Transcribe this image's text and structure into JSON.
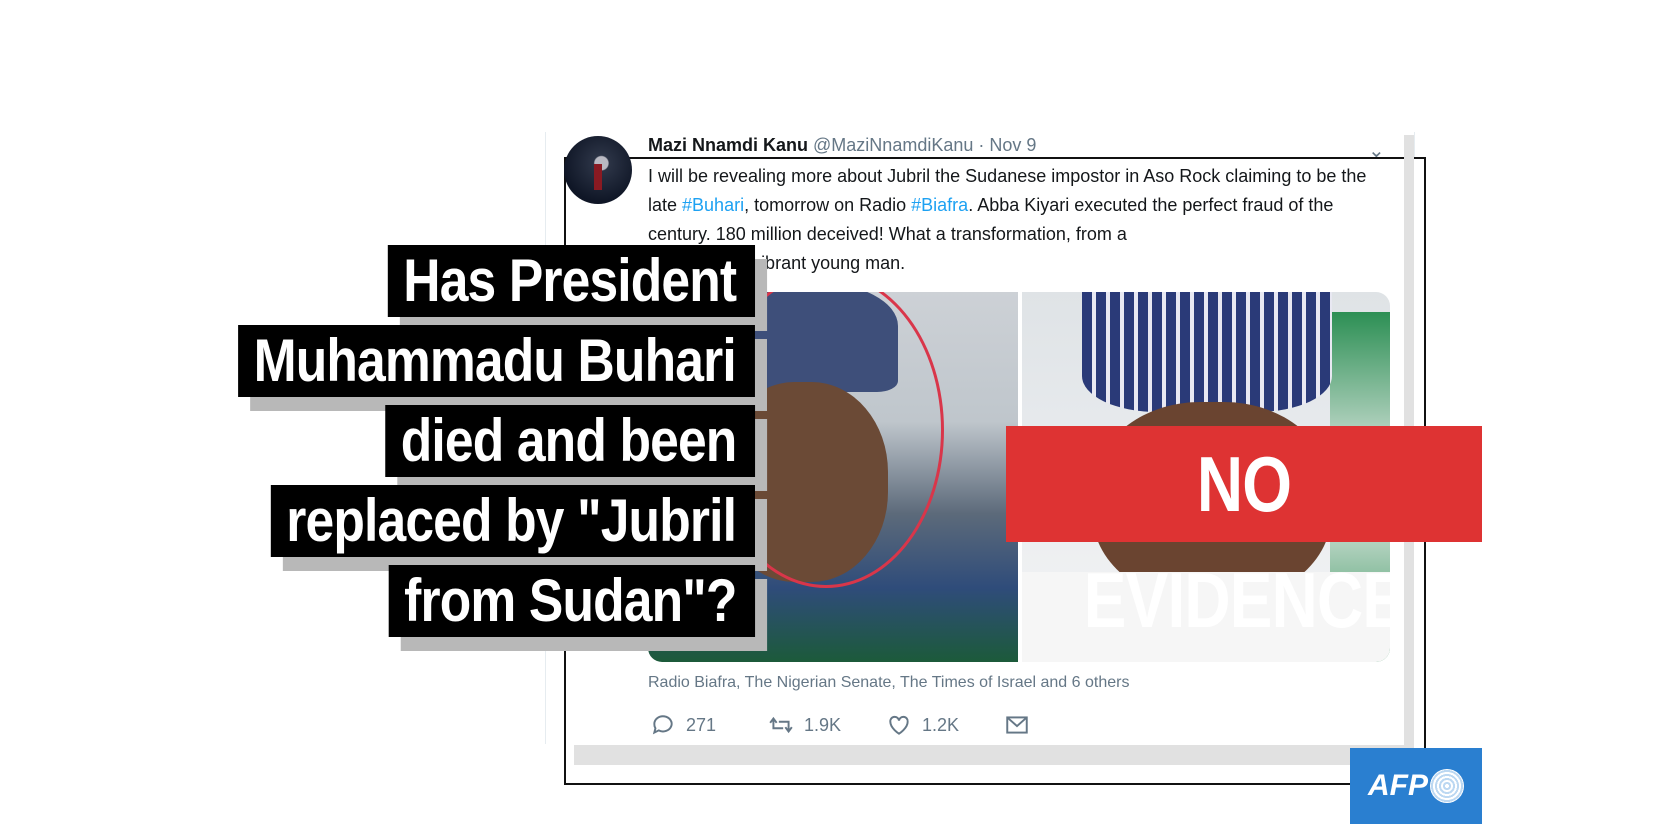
{
  "tweet": {
    "name": "Mazi Nnamdi Kanu",
    "handle": "@MaziNnamdiKanu",
    "separator": " · ",
    "date": "Nov 9",
    "text_1": "I will be revealing more about Jubril the Sudanese impostor in Aso Rock claiming to be the late ",
    "hashtag_1": "#Buhari",
    "text_2": ", tomorrow on Radio ",
    "hashtag_2": "#Biafra",
    "text_3": ". Abba Kiyari executed the perfect fraud of the century. 180 million deceived! What a transformation, from a",
    "text_4": "old man to a vibrant young man.",
    "sources": "Radio Biafra, The Nigerian Senate, The Times of Israel and 6 others",
    "replies": "271",
    "retweets": "1.9K",
    "likes": "1.2K",
    "caret_icon": "chevron-down-icon",
    "hashtag_color": "#1da1f2"
  },
  "headline": {
    "lines": [
      "Has President",
      "Muhammadu Buhari",
      "died and been",
      "replaced by \"Jubril",
      "from Sudan\"?"
    ]
  },
  "stamp": {
    "label": "NO EVIDENCE",
    "color": "#de3333"
  },
  "logo": {
    "label": "AFP",
    "color": "#2a7fd0"
  }
}
